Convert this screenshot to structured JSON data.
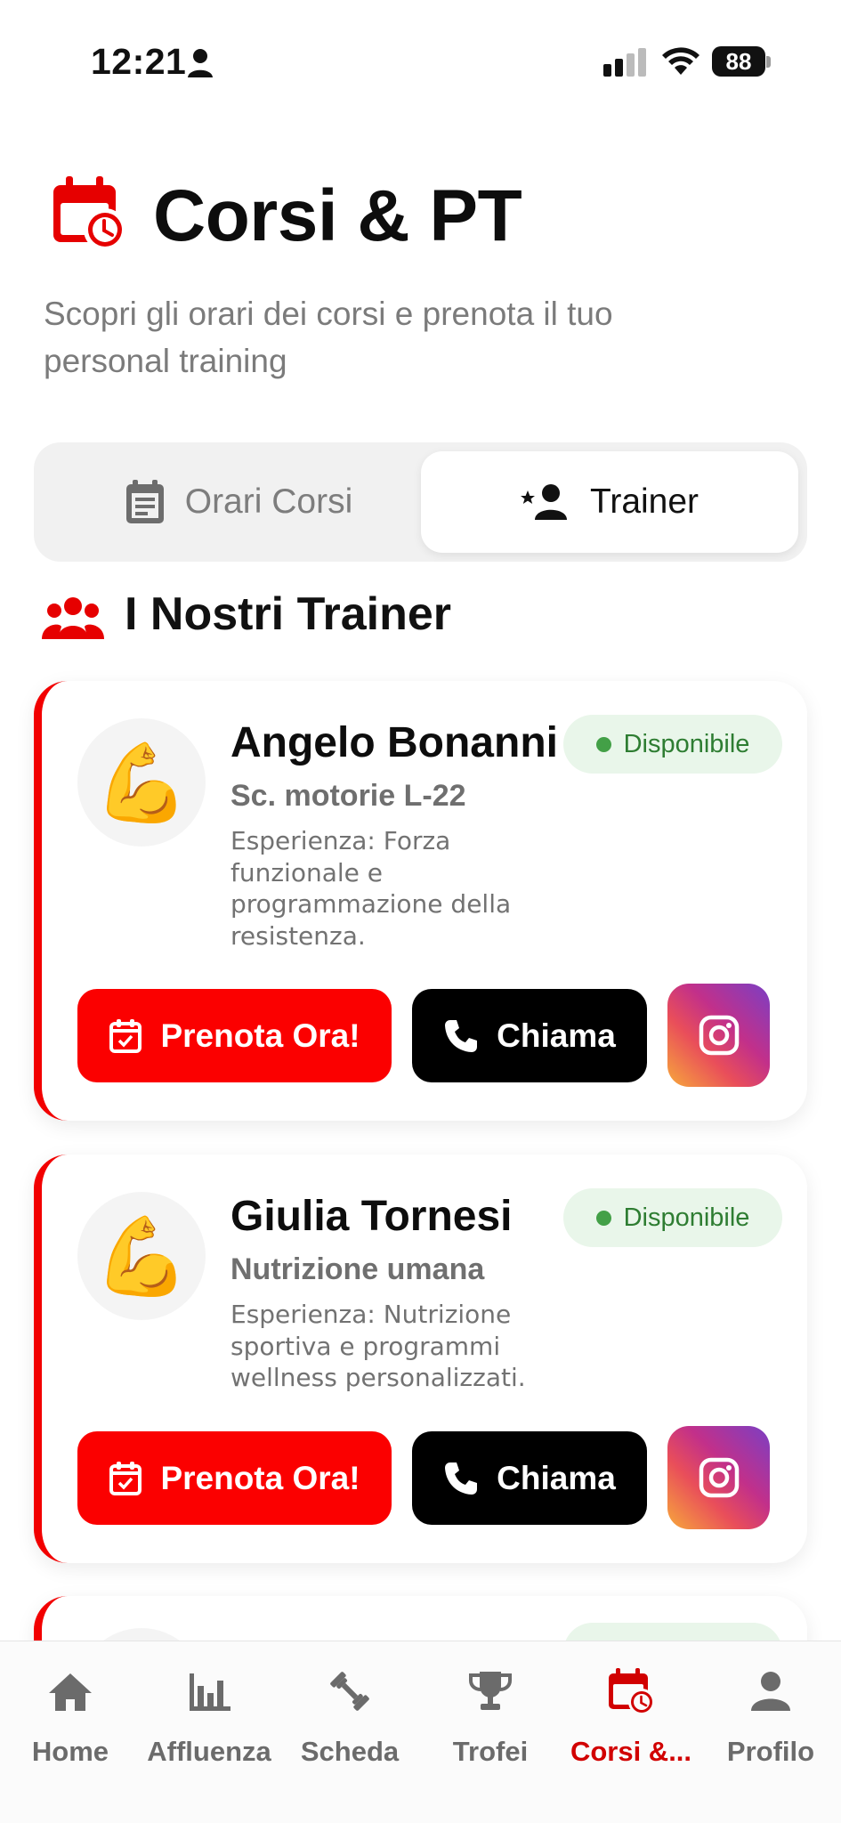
{
  "status_bar": {
    "time": "12:21",
    "battery": "88"
  },
  "header": {
    "title": "Corsi & PT",
    "subtitle": "Scopri gli orari dei corsi e prenota il tuo personal training"
  },
  "segmented": {
    "tabs": [
      {
        "label": "Orari Corsi",
        "selected": false
      },
      {
        "label": "Trainer",
        "selected": true
      }
    ]
  },
  "section": {
    "title": "I Nostri Trainer"
  },
  "trainers": [
    {
      "avatar": "💪",
      "name": "Angelo Bonanni",
      "status": "Disponibile",
      "role": "Sc. motorie L-22",
      "description": "Esperienza: Forza funzionale e programmazione della resistenza.",
      "book_label": "Prenota Ora!",
      "call_label": "Chiama",
      "instagram_icon": "instagram-icon"
    },
    {
      "avatar": "💪",
      "name": "Giulia Tornesi",
      "status": "Disponibile",
      "role": "Nutrizione umana",
      "description": "Esperienza: Nutrizione sportiva e programmi wellness personalizzati.",
      "book_label": "Prenota Ora!",
      "call_label": "Chiama",
      "instagram_icon": "instagram-icon"
    }
  ],
  "tabbar": {
    "items": [
      {
        "label": "Home",
        "icon": "home-icon",
        "active": false
      },
      {
        "label": "Affluenza",
        "icon": "bar-chart-icon",
        "active": false
      },
      {
        "label": "Scheda",
        "icon": "dumbbell-icon",
        "active": false
      },
      {
        "label": "Trofei",
        "icon": "trophy-icon",
        "active": false
      },
      {
        "label": "Corsi &...",
        "icon": "calendar-clock-icon",
        "active": true
      },
      {
        "label": "Profilo",
        "icon": "person-icon",
        "active": false
      }
    ]
  },
  "colors": {
    "accent": "#f20000",
    "call_button": "#000000",
    "available_badge_bg": "#e9f6ea",
    "available_text": "#2e7d32",
    "active_tab": "#d10000"
  }
}
